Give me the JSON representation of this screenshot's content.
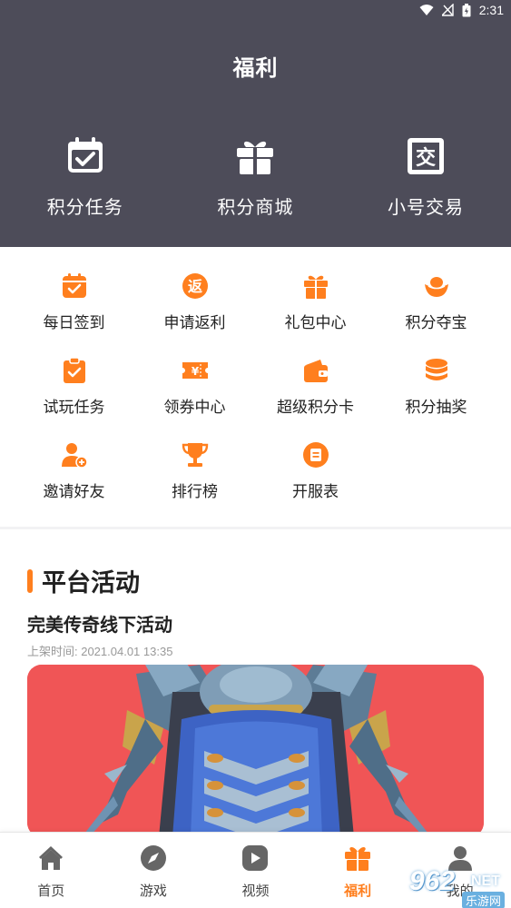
{
  "status_bar": {
    "time": "2:31"
  },
  "header": {
    "title": "福利",
    "actions": [
      {
        "label": "积分任务",
        "icon": "calendar-check-icon"
      },
      {
        "label": "积分商城",
        "icon": "gift-icon"
      },
      {
        "label": "小号交易",
        "icon": "exchange-icon"
      }
    ]
  },
  "grid": {
    "rows": [
      [
        {
          "label": "每日签到",
          "icon": "calendar-check-icon"
        },
        {
          "label": "申请返利",
          "icon": "rebate-icon"
        },
        {
          "label": "礼包中心",
          "icon": "gift-icon"
        },
        {
          "label": "积分夺宝",
          "icon": "gold-ingot-icon"
        }
      ],
      [
        {
          "label": "试玩任务",
          "icon": "clipboard-check-icon"
        },
        {
          "label": "领券中心",
          "icon": "coupon-icon"
        },
        {
          "label": "超级积分卡",
          "icon": "wallet-icon"
        },
        {
          "label": "积分抽奖",
          "icon": "coin-stack-icon"
        }
      ],
      [
        {
          "label": "邀请好友",
          "icon": "add-user-icon"
        },
        {
          "label": "排行榜",
          "icon": "trophy-icon"
        },
        {
          "label": "开服表",
          "icon": "server-list-icon"
        }
      ]
    ],
    "icon_color": "#ff7f1e"
  },
  "activity": {
    "section_title": "平台活动",
    "title": "完美传奇线下活动",
    "time": "上架时间: 2021.04.01 13:35",
    "banner_bg": "#f05556"
  },
  "bottom_nav": [
    {
      "label": "首页",
      "icon": "home-icon",
      "active": false
    },
    {
      "label": "游戏",
      "icon": "compass-icon",
      "active": false
    },
    {
      "label": "视频",
      "icon": "play-icon",
      "active": false
    },
    {
      "label": "福利",
      "icon": "gift-icon",
      "active": true
    },
    {
      "label": "我的",
      "icon": "user-icon",
      "active": false
    }
  ],
  "watermark": {
    "text1": "962",
    "text2": "NET",
    "text3": "乐游网"
  },
  "colors": {
    "header_bg": "#4d4c59",
    "accent": "#ff7f1e"
  }
}
